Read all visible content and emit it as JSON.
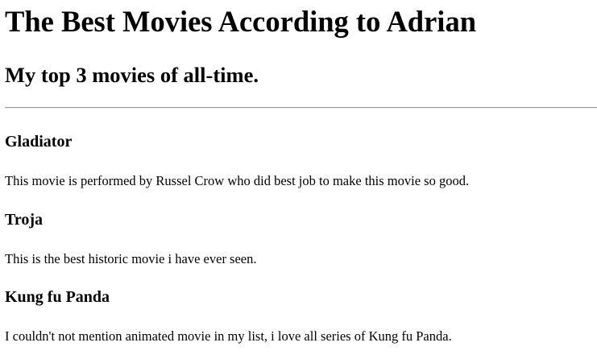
{
  "page": {
    "title": "The Best Movies According to Adrian",
    "subtitle": "My top 3 movies of all-time."
  },
  "movies": [
    {
      "title": "Gladiator",
      "description": "This movie is performed by Russel Crow who did best job to make this movie so good."
    },
    {
      "title": "Troja",
      "description": "This is the best historic movie i have ever seen."
    },
    {
      "title": "Kung fu Panda",
      "description": "I couldn't not mention animated movie in my list, i love all series of Kung fu Panda."
    }
  ],
  "colors": {
    "text": "#000000",
    "background": "#ffffff",
    "rule": "#9a9a9a"
  }
}
